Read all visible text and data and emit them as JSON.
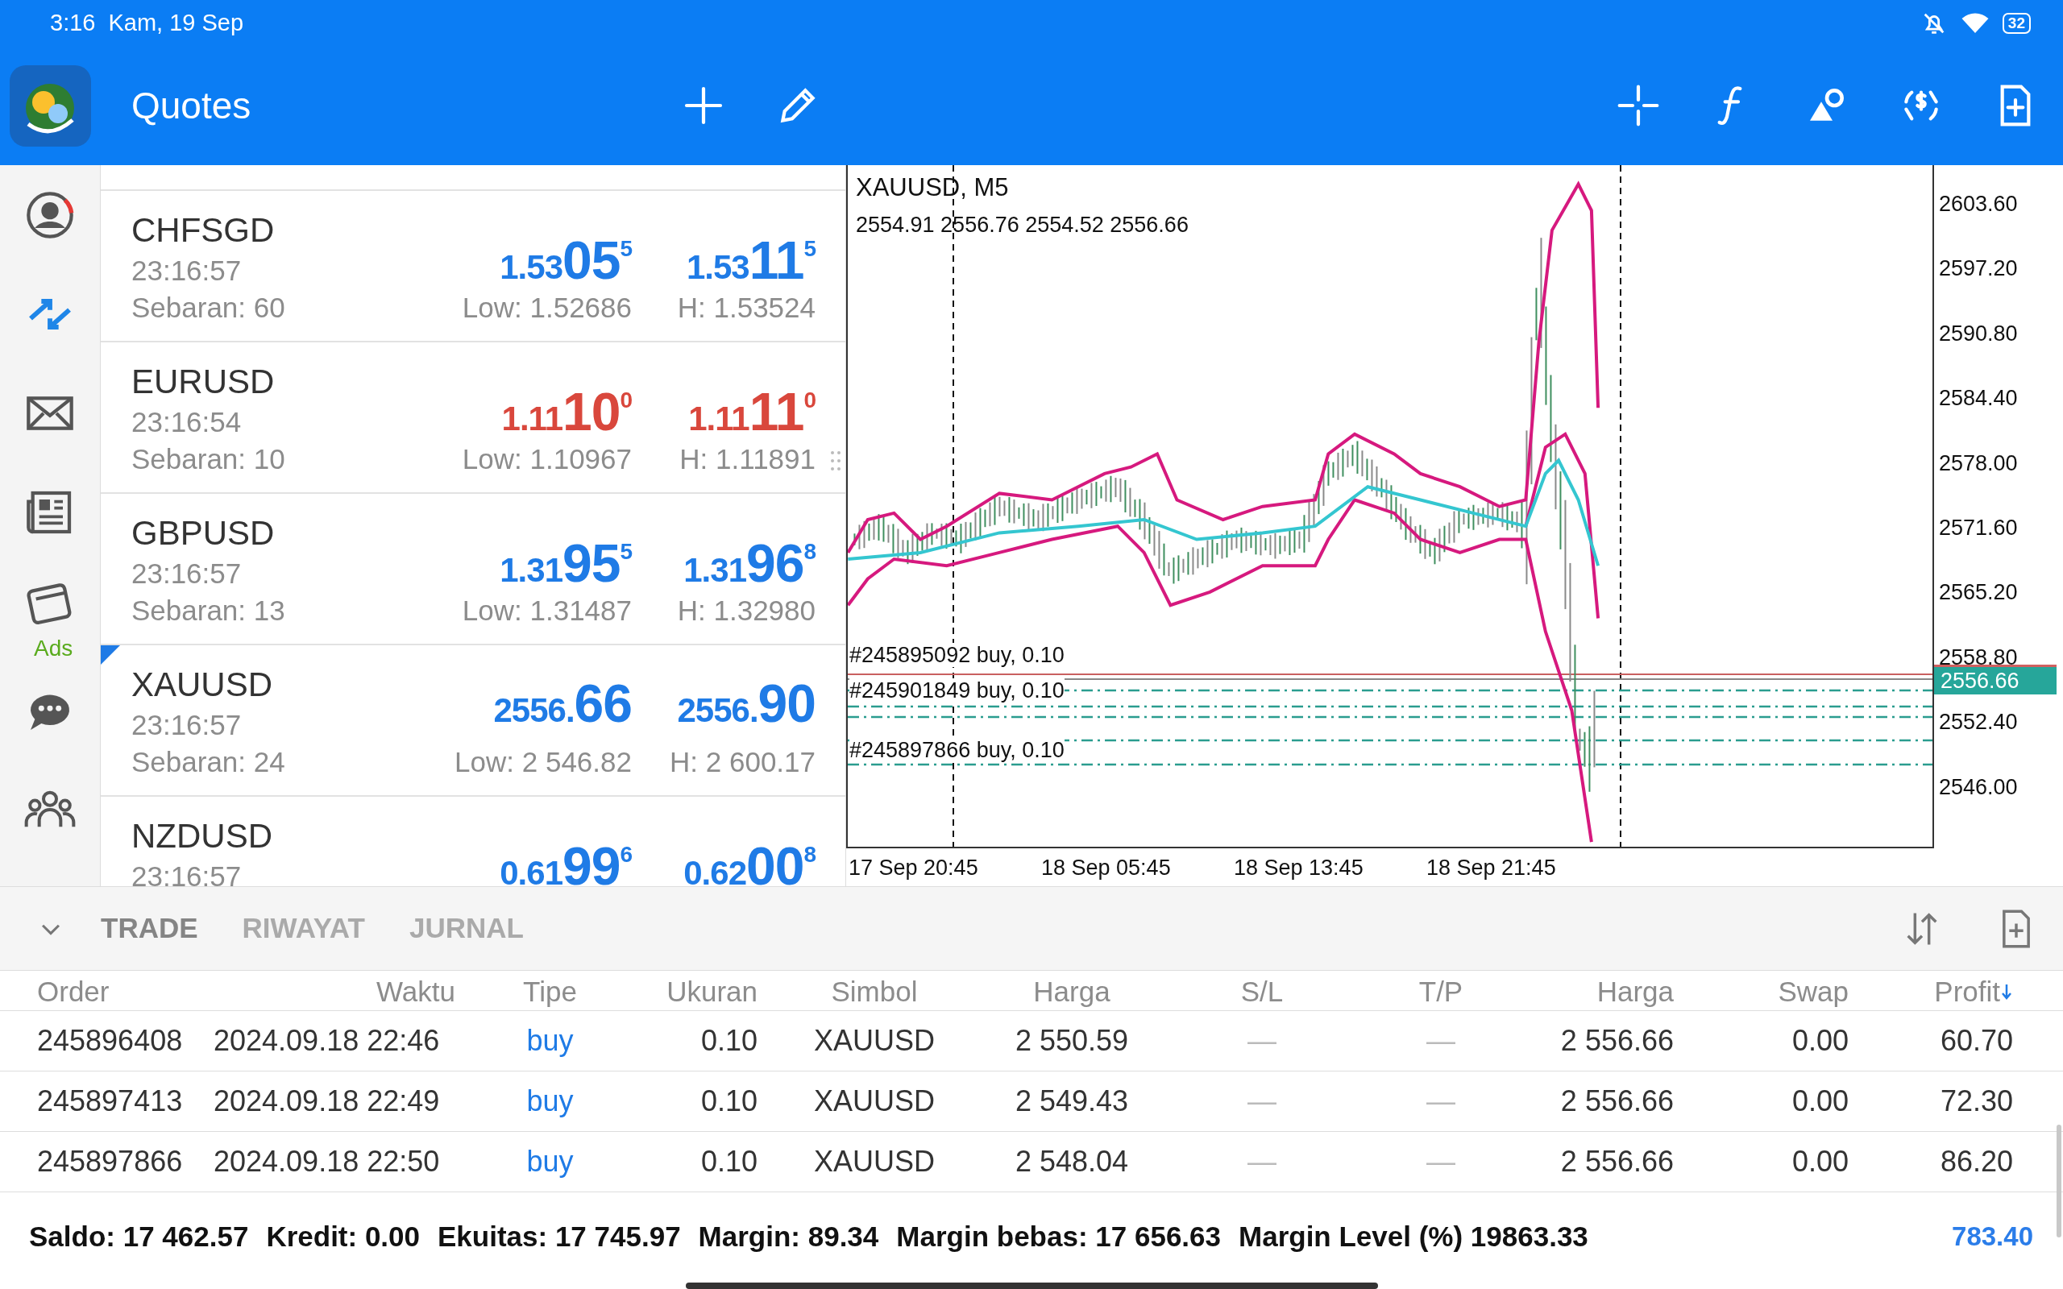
{
  "status_bar": {
    "time": "3:16",
    "date": "Kam, 19 Sep",
    "battery": "32"
  },
  "app_bar": {
    "title": "Quotes"
  },
  "sidebar": {
    "items": [
      {
        "kind": "profile",
        "selected": false
      },
      {
        "kind": "trade",
        "selected": true
      },
      {
        "kind": "mail",
        "selected": false
      },
      {
        "kind": "news",
        "selected": false
      },
      {
        "kind": "calendar",
        "selected": false,
        "badge": "Ads"
      },
      {
        "kind": "chat",
        "selected": false
      },
      {
        "kind": "community",
        "selected": false
      }
    ]
  },
  "quotes": [
    {
      "symbol": "CHFSGD",
      "time": "23:16:57",
      "spread": "Sebaran: 60",
      "color": "#1f7be6",
      "selected": false,
      "bid": {
        "prefix": "1.53",
        "big": "05",
        "sup": "5"
      },
      "ask": {
        "prefix": "1.53",
        "big": "11",
        "sup": "5"
      },
      "low": "Low: 1.52686",
      "high": "H: 1.53524"
    },
    {
      "symbol": "EURUSD",
      "time": "23:16:54",
      "spread": "Sebaran: 10",
      "color": "#d9473c",
      "selected": false,
      "bid": {
        "prefix": "1.11",
        "big": "10",
        "sup": "0"
      },
      "ask": {
        "prefix": "1.11",
        "big": "11",
        "sup": "0"
      },
      "low": "Low: 1.10967",
      "high": "H: 1.11891"
    },
    {
      "symbol": "GBPUSD",
      "time": "23:16:57",
      "spread": "Sebaran: 13",
      "color": "#1f7be6",
      "selected": false,
      "bid": {
        "prefix": "1.31",
        "big": "95",
        "sup": "5"
      },
      "ask": {
        "prefix": "1.31",
        "big": "96",
        "sup": "8"
      },
      "low": "Low: 1.31487",
      "high": "H: 1.32980"
    },
    {
      "symbol": "XAUUSD",
      "time": "23:16:57",
      "spread": "Sebaran: 24",
      "color": "#1f7be6",
      "selected": true,
      "bid": {
        "prefix": "2556.",
        "big": "66"
      },
      "ask": {
        "prefix": "2556.",
        "big": "90"
      },
      "low": "Low: 2 546.82",
      "high": "H: 2 600.17"
    },
    {
      "symbol": "NZDUSD",
      "time": "23:16:57",
      "color": "#1f7be6",
      "selected": false,
      "bid": {
        "prefix": "0.61",
        "big": "99",
        "sup": "6"
      },
      "ask": {
        "prefix": "0.62",
        "big": "00",
        "sup": "8"
      }
    }
  ],
  "chart": {
    "title": "XAUUSD, M5",
    "ohlc": "2554.91 2556.76 2554.52 2556.66",
    "orders": [
      "#245895092 buy, 0.10",
      "#245901849 buy, 0.10",
      "#245897866 buy, 0.10"
    ],
    "price_labels": [
      "2603.60",
      "2597.20",
      "2590.80",
      "2584.40",
      "2578.00",
      "2571.60",
      "2565.20",
      "2558.80",
      "2552.40",
      "2546.00"
    ],
    "current_price": "2556.66",
    "time_labels": [
      "17 Sep 20:45",
      "18 Sep 05:45",
      "18 Sep 13:45",
      "18 Sep 21:45"
    ]
  },
  "terminal": {
    "tabs": [
      {
        "label": "TRADE",
        "selected": true
      },
      {
        "label": "RIWAYAT",
        "selected": false
      },
      {
        "label": "JURNAL",
        "selected": false
      }
    ],
    "columns": [
      "Order",
      "Waktu",
      "Tipe",
      "Ukuran",
      "Simbol",
      "Harga",
      "S/L",
      "T/P",
      "Harga",
      "Swap",
      "Profit"
    ],
    "rows": [
      [
        "245896408",
        "2024.09.18 22:46",
        "buy",
        "0.10",
        "XAUUSD",
        "2 550.59",
        "—",
        "—",
        "2 556.66",
        "0.00",
        "60.70"
      ],
      [
        "245897413",
        "2024.09.18 22:49",
        "buy",
        "0.10",
        "XAUUSD",
        "2 549.43",
        "—",
        "—",
        "2 556.66",
        "0.00",
        "72.30"
      ],
      [
        "245897866",
        "2024.09.18 22:50",
        "buy",
        "0.10",
        "XAUUSD",
        "2 548.04",
        "—",
        "—",
        "2 556.66",
        "0.00",
        "86.20"
      ]
    ],
    "summary": [
      {
        "label": "Saldo:",
        "value": "17 462.57"
      },
      {
        "label": "Kredit:",
        "value": "0.00"
      },
      {
        "label": "Ekuitas:",
        "value": "17 745.97"
      },
      {
        "label": "Margin:",
        "value": "89.34"
      },
      {
        "label": "Margin bebas:",
        "value": "17 656.63"
      },
      {
        "label": "Margin Level (%)",
        "value": "19863.33"
      }
    ],
    "total_profit": "783.40"
  }
}
